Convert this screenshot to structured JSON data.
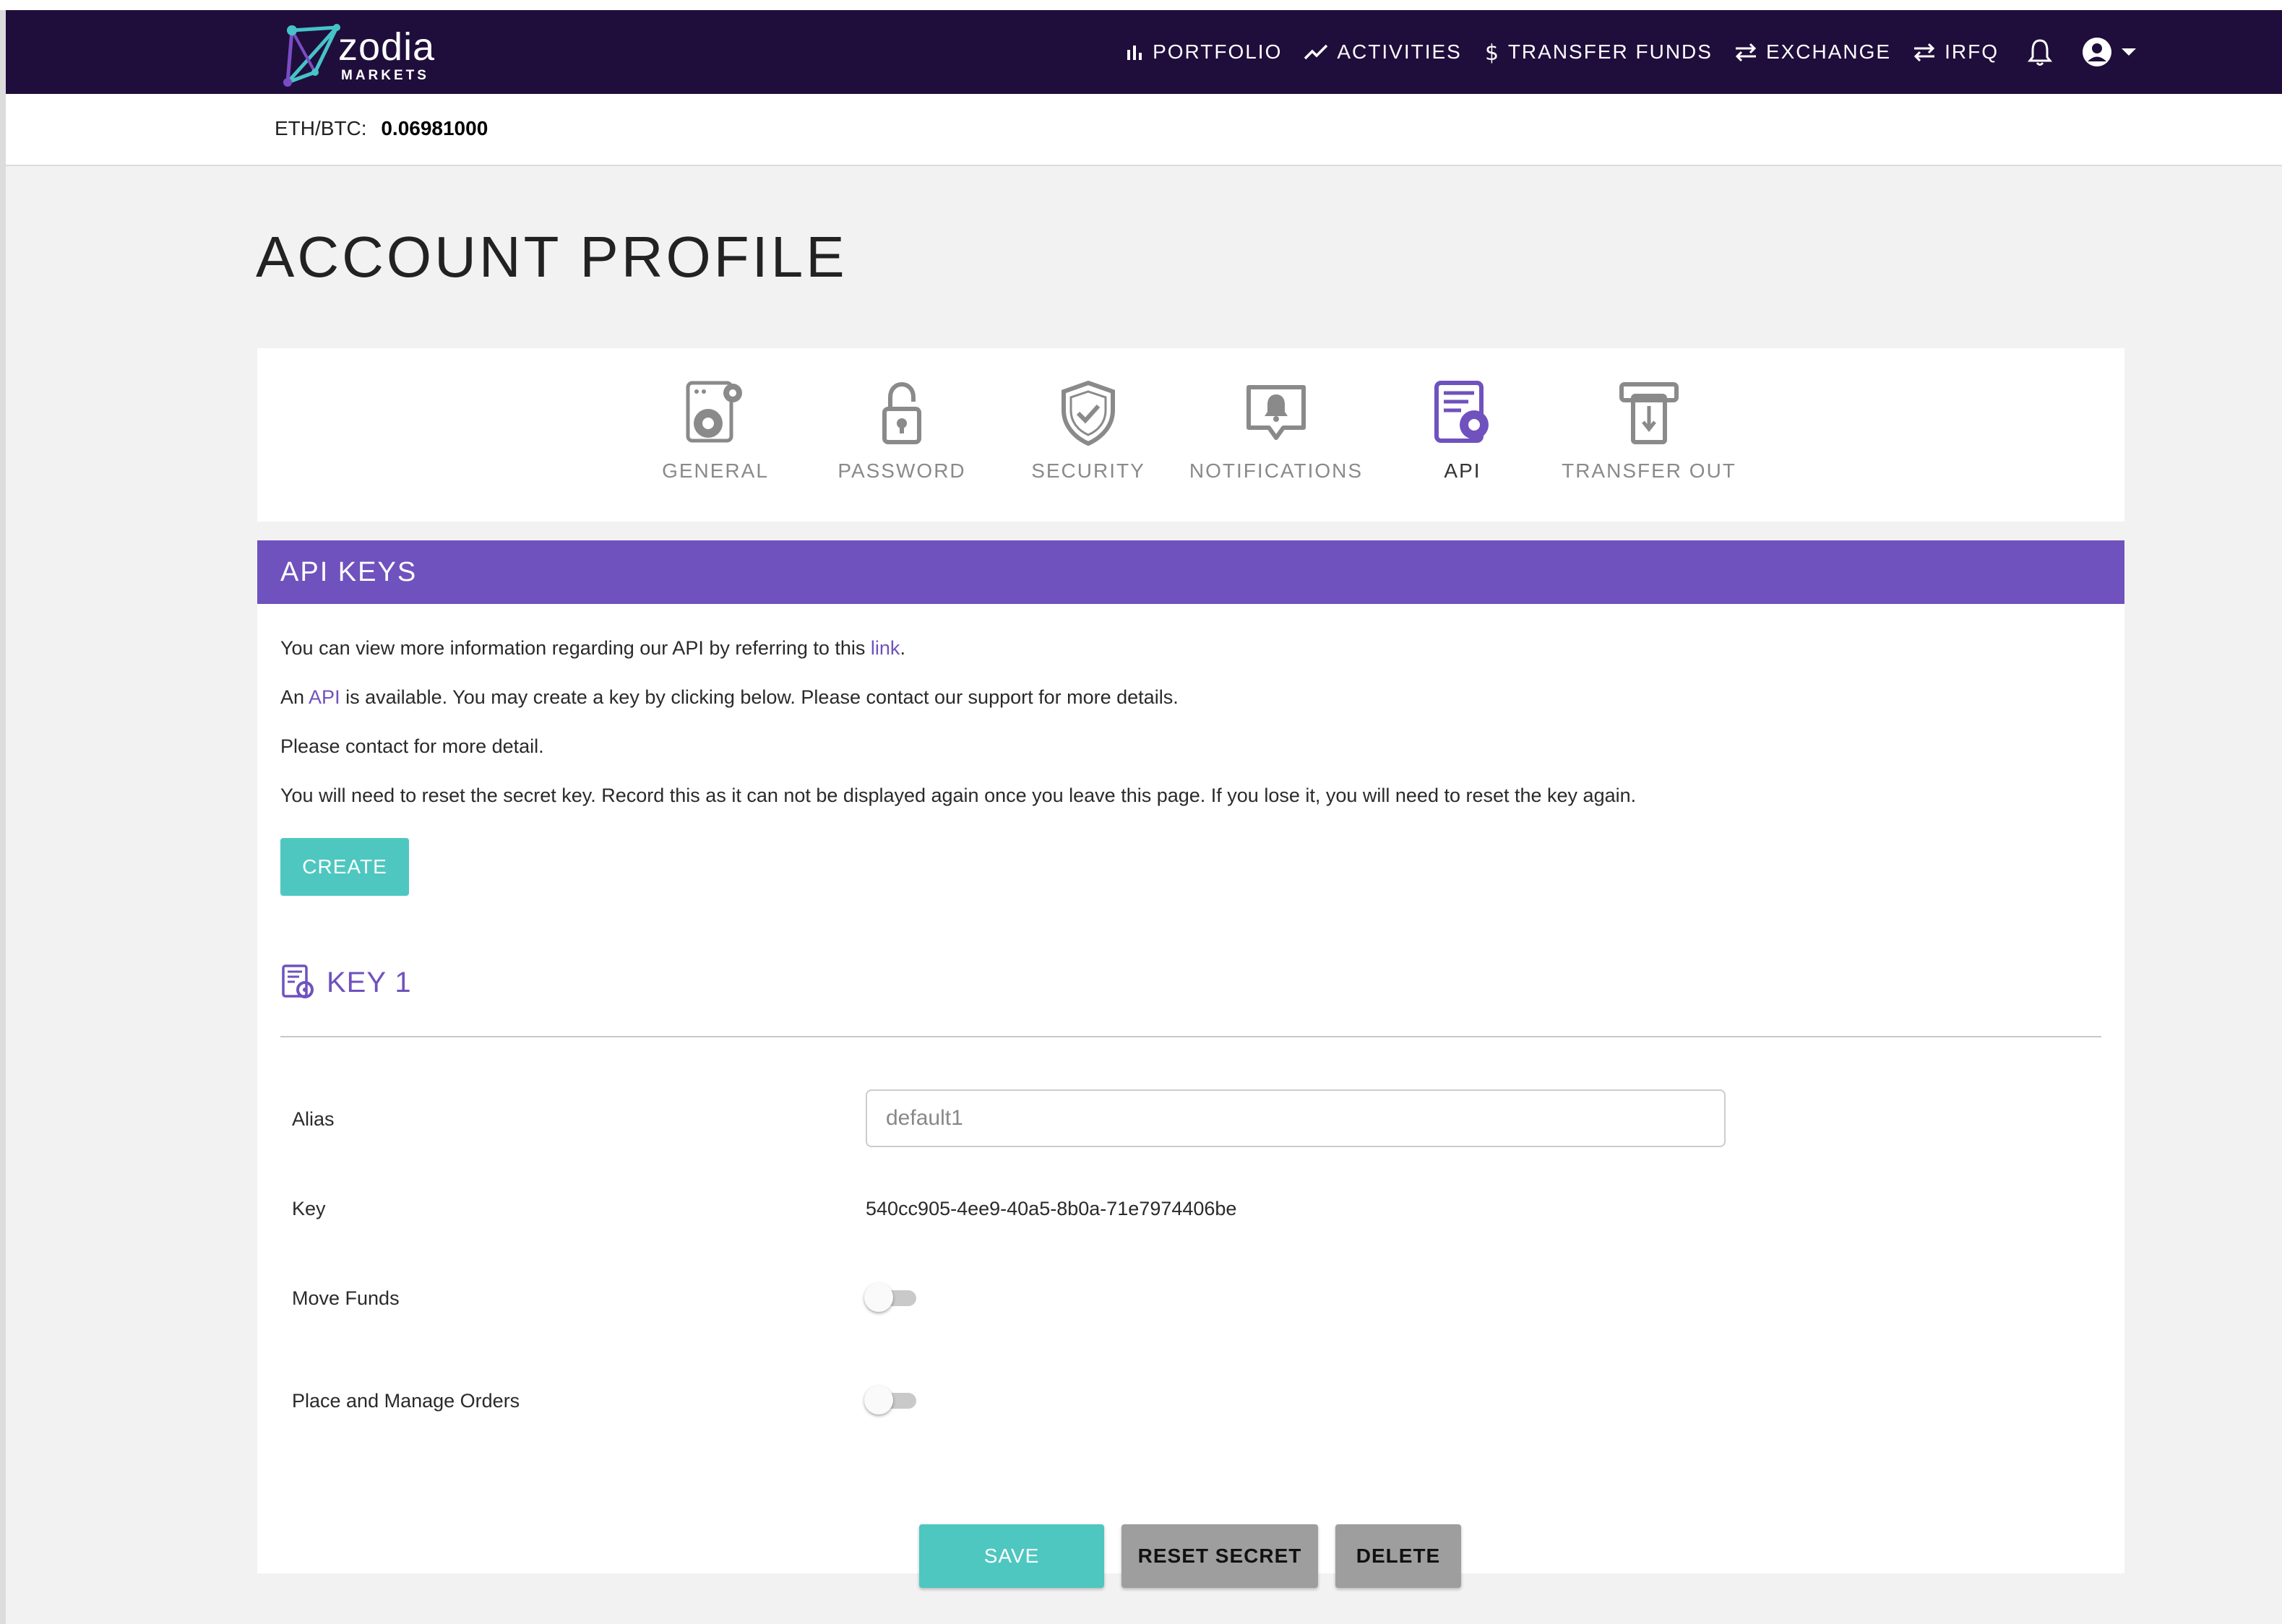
{
  "brand": {
    "name": "zodia",
    "sub": "MARKETS",
    "nav_bg": "#1f0e3b",
    "accent": "#6f52bd",
    "teal": "#4ec7c0"
  },
  "nav": {
    "items": [
      {
        "label": "PORTFOLIO",
        "icon": "bar-chart-icon"
      },
      {
        "label": "ACTIVITIES",
        "icon": "trend-line-icon"
      },
      {
        "label": "TRANSFER FUNDS",
        "icon": "dollar-icon"
      },
      {
        "label": "EXCHANGE",
        "icon": "swap-arrows-icon"
      },
      {
        "label": "IRFQ",
        "icon": "swap-arrows-icon"
      }
    ],
    "bell_icon": "bell-icon",
    "user_icon": "user-circle-icon"
  },
  "ticker": {
    "pair": "ETH/BTC:",
    "value": "0.06981000"
  },
  "page": {
    "title": "ACCOUNT PROFILE"
  },
  "tabs": [
    {
      "label": "GENERAL",
      "icon": "settings-gears-icon",
      "active": false
    },
    {
      "label": "PASSWORD",
      "icon": "padlock-icon",
      "active": false
    },
    {
      "label": "SECURITY",
      "icon": "shield-check-icon",
      "active": false
    },
    {
      "label": "NOTIFICATIONS",
      "icon": "bell-bubble-icon",
      "active": false
    },
    {
      "label": "API",
      "icon": "api-doc-gear-icon",
      "active": true
    },
    {
      "label": "TRANSFER OUT",
      "icon": "atm-withdraw-icon",
      "active": false
    }
  ],
  "api": {
    "header": "API KEYS",
    "para1_pre": "You can view more information regarding our API by referring to this ",
    "para1_link": "link",
    "para1_post": ".",
    "para2_pre": "An ",
    "para2_link": "API",
    "para2_post": " is available. You may create a key by clicking below. Please contact our support for more details.",
    "para3": "Please contact for more detail.",
    "para4": "You will need to reset the secret key. Record this as it can not be displayed again once you leave this page. If you lose it, you will need to reset the key again.",
    "create_label": "CREATE"
  },
  "key": {
    "title": "KEY 1",
    "alias_label": "Alias",
    "alias_value": "default1",
    "key_label": "Key",
    "key_value": "540cc905-4ee9-40a5-8b0a-71e7974406be",
    "move_funds_label": "Move Funds",
    "move_funds_on": false,
    "orders_label": "Place and Manage Orders",
    "orders_on": false,
    "save_label": "SAVE",
    "reset_label": "RESET SECRET",
    "delete_label": "DELETE"
  }
}
